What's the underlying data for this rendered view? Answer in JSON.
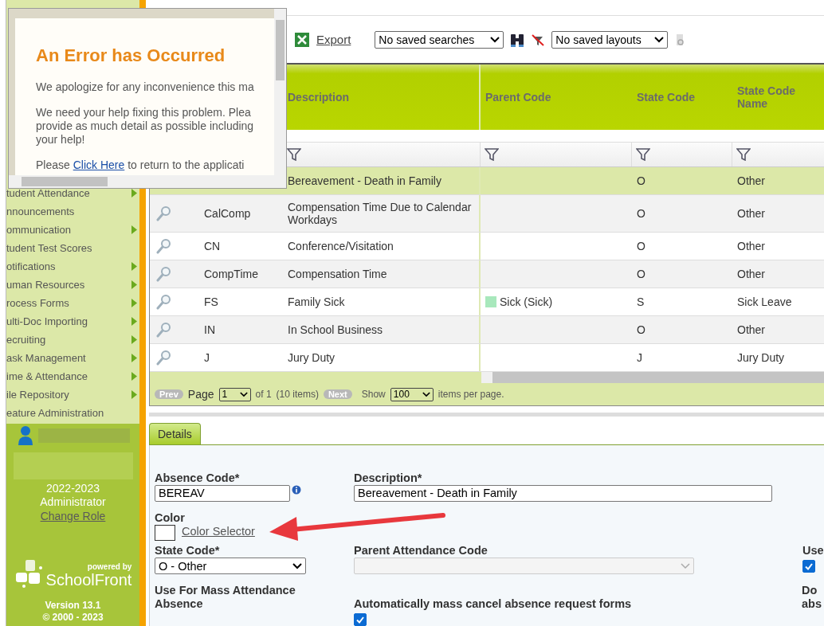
{
  "error_dialog": {
    "title": "An Error has Occurred",
    "paragraphs": [
      {
        "lines": [
          "We apologize for any inconvenience this ma"
        ]
      },
      {
        "lines": [
          "We need your help fixing this problem. Plea",
          "provide as much detail as possible including",
          "your help!"
        ]
      }
    ],
    "last_line": {
      "before": "Please ",
      "link": "Click Here",
      "after": " to return to the applicati"
    }
  },
  "toolbar": {
    "export": "Export",
    "saved_searches": "No saved searches",
    "saved_layouts": "No saved layouts"
  },
  "table": {
    "columns": [
      "Description",
      "Parent Code",
      "State Code",
      "State Code Name"
    ],
    "rows": [
      {
        "description": "Bereavement - Death in Family",
        "state_code": "O",
        "state_code_name": "Other",
        "selected": true
      },
      {
        "code": "CalComp",
        "description": "Compensation Time Due to Calendar Workdays",
        "state_code": "O",
        "state_code_name": "Other",
        "selected": false
      },
      {
        "code": "CN",
        "description": "Conference/Visitation",
        "state_code": "O",
        "state_code_name": "Other",
        "selected": false
      },
      {
        "code": "CompTime",
        "description": "Compensation Time",
        "state_code": "O",
        "state_code_name": "Other",
        "selected": false
      },
      {
        "code": "FS",
        "description": "Family Sick",
        "parent_code": "Sick (Sick)",
        "color": "#a8e8bc",
        "state_code": "S",
        "state_code_name": "Sick Leave",
        "selected": false
      },
      {
        "code": "IN",
        "description": "In School Business",
        "state_code": "O",
        "state_code_name": "Other",
        "selected": false
      },
      {
        "code": "J",
        "description": "Jury Duty",
        "state_code": "J",
        "state_code_name": "Jury Duty",
        "selected": false
      }
    ],
    "pager": {
      "prev": "Prev",
      "page_label": "Page",
      "page": "1",
      "of": "of 1",
      "items": "(10  items)",
      "next": "Next",
      "show": "Show",
      "per_page": "100",
      "per_page_label": "items per page."
    }
  },
  "sidebar": {
    "items": [
      {
        "label": "tudent Attendance",
        "submenu": true
      },
      {
        "label": "nnouncements",
        "submenu": false
      },
      {
        "label": "ommunication",
        "submenu": true
      },
      {
        "label": "tudent Test Scores",
        "submenu": false
      },
      {
        "label": "otifications",
        "submenu": true
      },
      {
        "label": "uman Resources",
        "submenu": true
      },
      {
        "label": "rocess Forms",
        "submenu": true
      },
      {
        "label": "ulti-Doc Importing",
        "submenu": true
      },
      {
        "label": "ecruiting",
        "submenu": true
      },
      {
        "label": "ask Management",
        "submenu": true
      },
      {
        "label": "ime & Attendance",
        "submenu": true
      },
      {
        "label": "ile Repository",
        "submenu": true
      },
      {
        "label": "eature Administration",
        "submenu": false
      }
    ],
    "year": "2022-2023",
    "role": "Administrator",
    "change_role": "Change Role",
    "powered_by": "powered by",
    "brand": "SchoolFront",
    "version": "Version 13.1",
    "copyright": "© 2000 - 2023"
  },
  "details": {
    "tab": "Details",
    "absence_code": {
      "label": "Absence Code*",
      "value": "BEREAV"
    },
    "description": {
      "label": "Description*",
      "value": "Bereavement - Death in Family"
    },
    "color": {
      "label": "Color",
      "link": "Color Selector"
    },
    "state_code": {
      "label": "State Code*",
      "value": "O - Other"
    },
    "parent_attendance_code": {
      "label": "Parent Attendance Code",
      "disabled": true
    },
    "mass_absence": {
      "label": "Use For Mass Attendance Absence"
    },
    "auto_cancel": {
      "label": "Automatically mass cancel absence request forms",
      "checked": true
    },
    "right_use": {
      "label": "Use",
      "checked": true
    },
    "right_do": [
      "Do",
      "abs"
    ]
  }
}
